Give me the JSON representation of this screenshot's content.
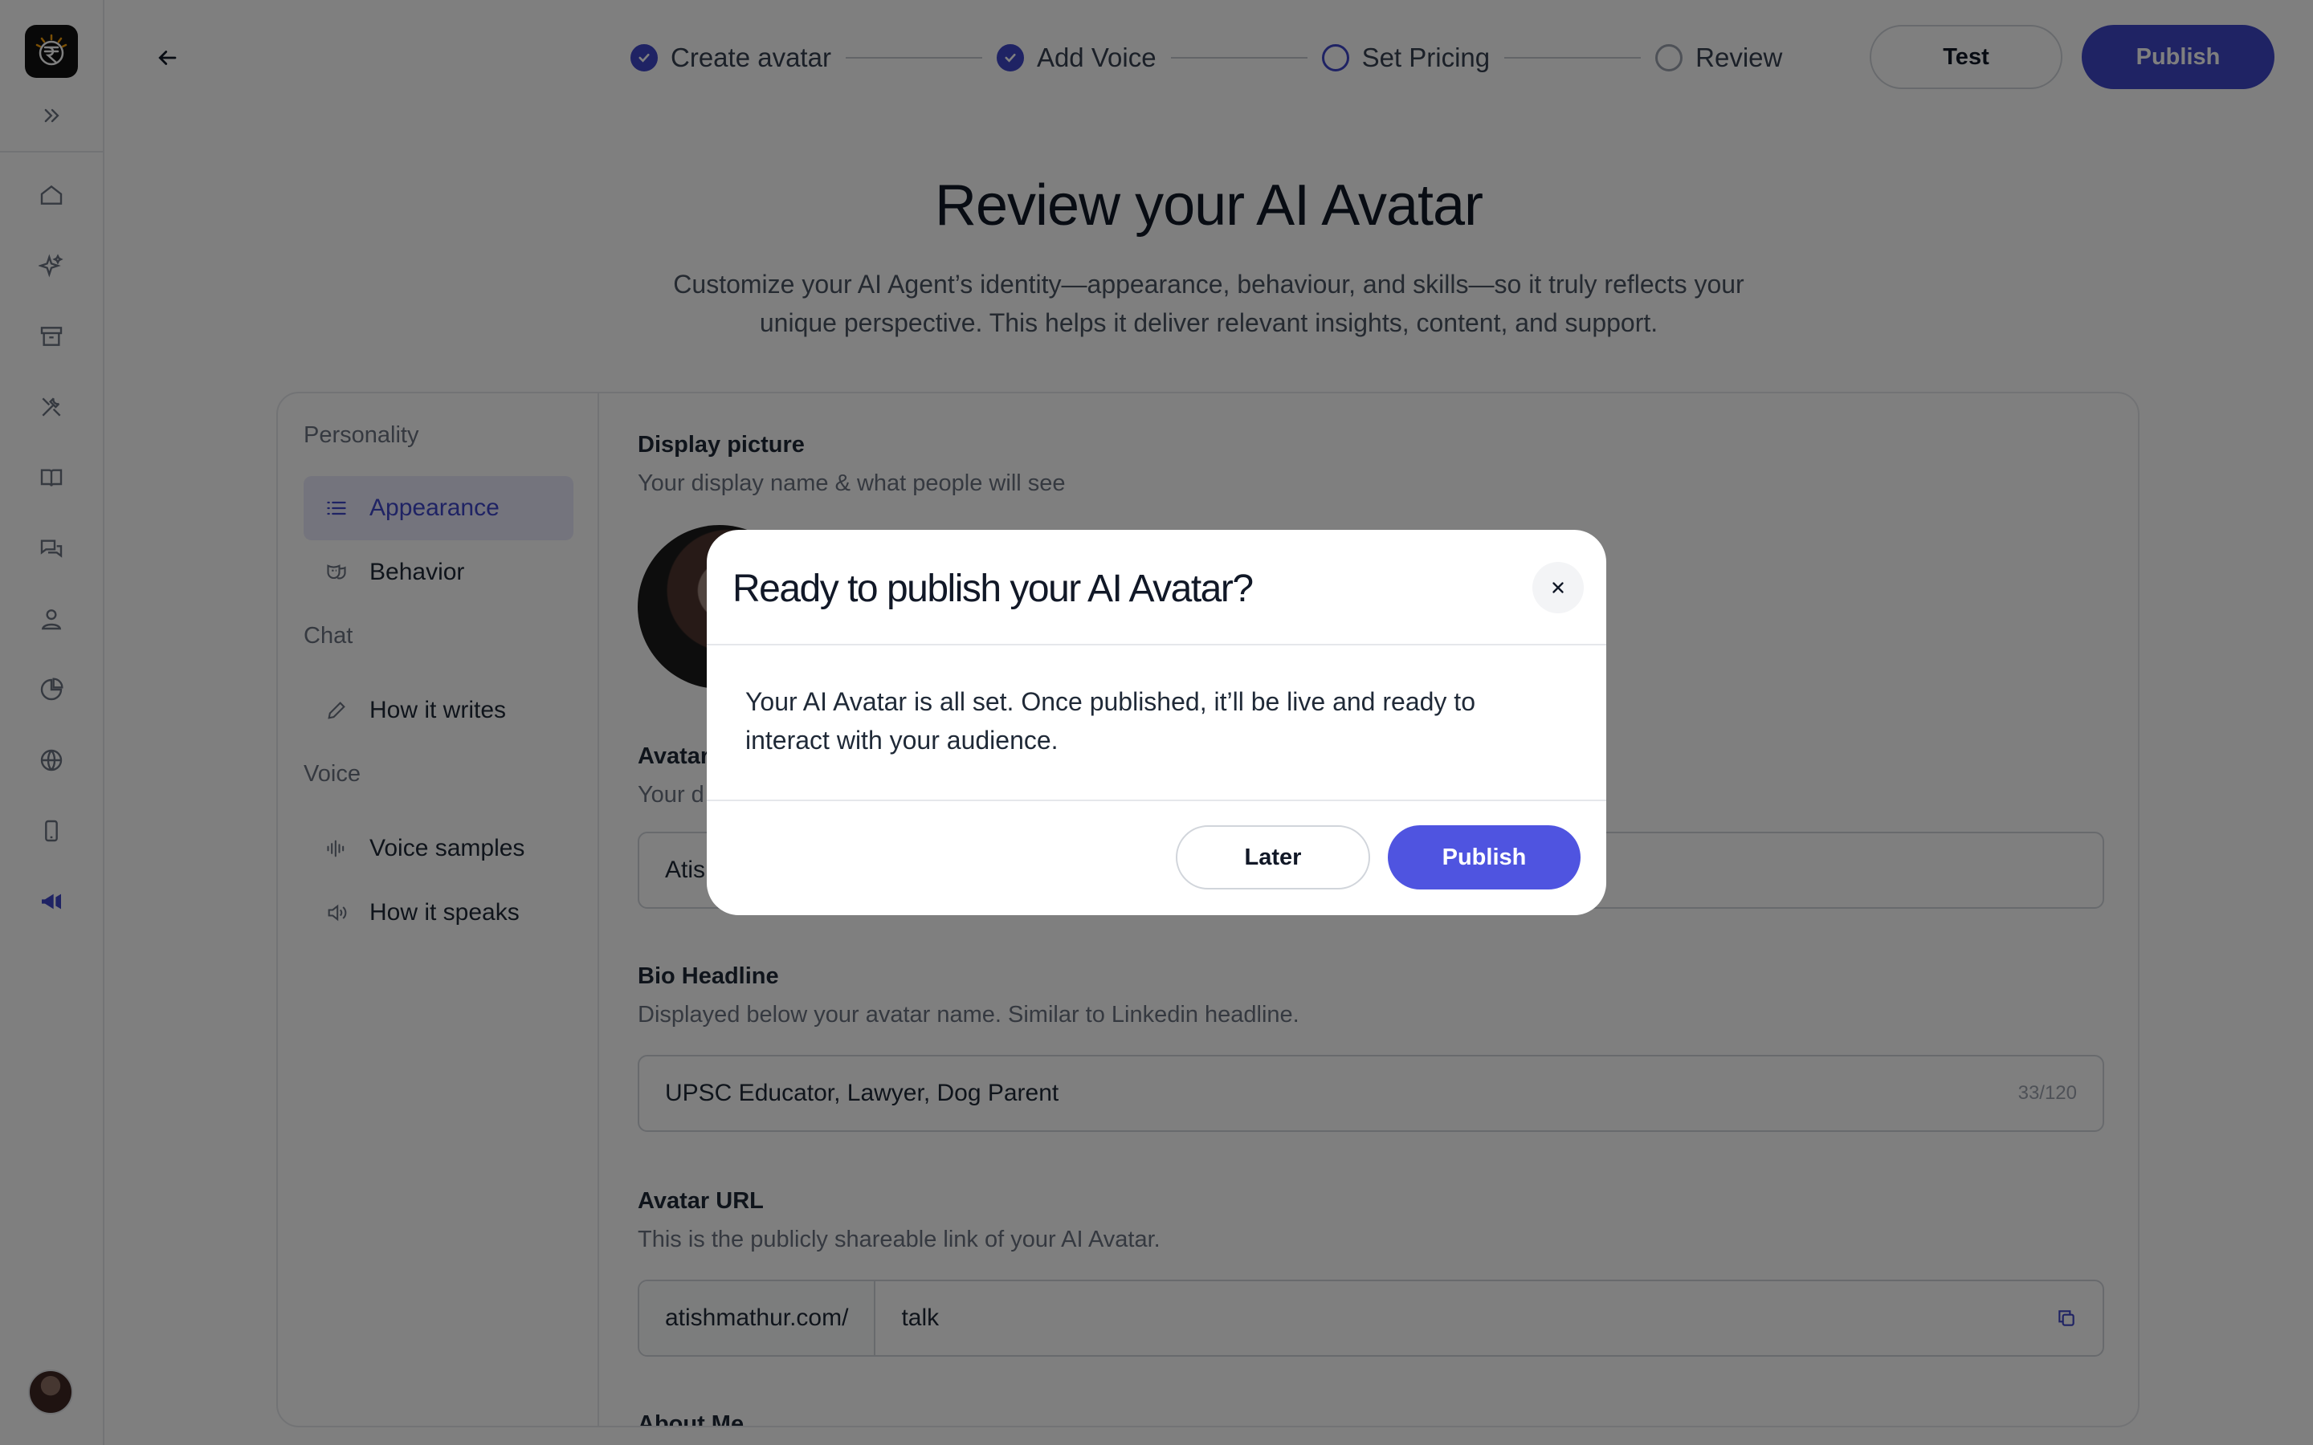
{
  "stepper": {
    "steps": [
      {
        "label": "Create avatar",
        "status": "done"
      },
      {
        "label": "Add Voice",
        "status": "done"
      },
      {
        "label": "Set Pricing",
        "status": "current"
      },
      {
        "label": "Review",
        "status": "pending"
      }
    ]
  },
  "header": {
    "test_label": "Test",
    "publish_label": "Publish"
  },
  "page": {
    "title": "Review your AI Avatar",
    "subtitle": "Customize your AI Agent’s identity—appearance, behaviour, and skills—so it truly reflects your unique perspective. This helps it deliver relevant insights, content, and support."
  },
  "nav": {
    "groups": [
      {
        "label": "Personality",
        "items": [
          {
            "label": "Appearance",
            "icon": "list-icon",
            "active": true
          },
          {
            "label": "Behavior",
            "icon": "mask-icon",
            "active": false
          }
        ]
      },
      {
        "label": "Chat",
        "items": [
          {
            "label": "How it writes",
            "icon": "pencil-icon",
            "active": false
          }
        ]
      },
      {
        "label": "Voice",
        "items": [
          {
            "label": "Voice samples",
            "icon": "waveform-icon",
            "active": false
          },
          {
            "label": "How it speaks",
            "icon": "speaker-icon",
            "active": false
          }
        ]
      }
    ]
  },
  "form": {
    "display_picture": {
      "label": "Display picture",
      "help": "Your display name & what people will see"
    },
    "avatar_name": {
      "label": "Avatar",
      "help": "Your d",
      "value": "Atish"
    },
    "bio": {
      "label": "Bio Headline",
      "help": "Displayed below your avatar name. Similar to Linkedin headline.",
      "value": "UPSC Educator, Lawyer, Dog Parent",
      "counter": "33/120"
    },
    "url": {
      "label": "Avatar URL",
      "help": "This is the publicly shareable link of your AI Avatar.",
      "prefix": "atishmathur.com/",
      "value": "talk"
    },
    "about": {
      "label": "About Me"
    }
  },
  "modal": {
    "title": "Ready to publish your AI Avatar?",
    "body": "Your AI Avatar is all set. Once published, it’ll be live and ready to interact with your audience.",
    "later_label": "Later",
    "publish_label": "Publish"
  },
  "colors": {
    "accent": "#3f46c8",
    "modal_primary": "#4f54e0",
    "overlay": "rgba(0,0,0,0.5)"
  }
}
